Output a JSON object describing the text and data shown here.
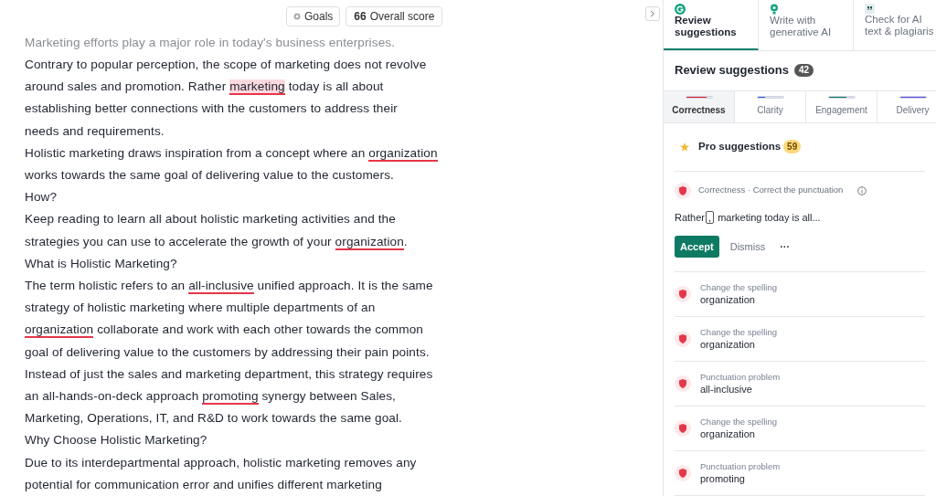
{
  "toolbar": {
    "goals": "Goals",
    "score_value": "66",
    "score_label": "Overall score"
  },
  "document": {
    "lines": [
      [
        {
          "kind": "plain",
          "text": "Marketing efforts play a major role in today's business enterprises."
        }
      ],
      [
        {
          "kind": "plain",
          "text": "Contrary to popular perception, the scope of marketing does not revolve"
        }
      ],
      [
        {
          "kind": "plain",
          "text": "around sales and promotion. Rather "
        },
        {
          "kind": "highlight",
          "text": "marketing"
        },
        {
          "kind": "plain",
          "text": " today is all about"
        }
      ],
      [
        {
          "kind": "plain",
          "text": "establishing better connections with the customers to address their"
        }
      ],
      [
        {
          "kind": "plain",
          "text": "needs and requirements."
        }
      ],
      [
        {
          "kind": "plain",
          "text": "Holistic marketing draws inspiration from a concept where an "
        },
        {
          "kind": "underline",
          "text": "organization"
        }
      ],
      [
        {
          "kind": "plain",
          "text": "works towards the same goal of delivering value to the customers."
        }
      ],
      [
        {
          "kind": "plain",
          "text": "How?"
        }
      ],
      [
        {
          "kind": "plain",
          "text": "Keep reading to learn all about holistic marketing activities and the"
        }
      ],
      [
        {
          "kind": "plain",
          "text": "strategies you can use to accelerate the growth of your "
        },
        {
          "kind": "underline",
          "text": "organization"
        },
        {
          "kind": "plain",
          "text": "."
        }
      ],
      [
        {
          "kind": "plain",
          "text": "What is Holistic Marketing?"
        }
      ],
      [
        {
          "kind": "plain",
          "text": "The term holistic refers to an "
        },
        {
          "kind": "underline",
          "text": "all-inclusive"
        },
        {
          "kind": "plain",
          "text": " unified approach. It is the same"
        }
      ],
      [
        {
          "kind": "plain",
          "text": "strategy of holistic marketing where multiple departments of an"
        }
      ],
      [
        {
          "kind": "underline",
          "text": "organization"
        },
        {
          "kind": "plain",
          "text": " collaborate and work with each other towards the common"
        }
      ],
      [
        {
          "kind": "plain",
          "text": "goal of delivering value to the customers by addressing their pain points."
        }
      ],
      [
        {
          "kind": "plain",
          "text": "Instead of just the sales and marketing department, this strategy requires"
        }
      ],
      [
        {
          "kind": "plain",
          "text": "an all-hands-on-deck approach "
        },
        {
          "kind": "underline",
          "text": "promoting"
        },
        {
          "kind": "plain",
          "text": " synergy between Sales,"
        }
      ],
      [
        {
          "kind": "plain",
          "text": "Marketing, Operations, IT, and R&D to work towards the same goal."
        }
      ],
      [
        {
          "kind": "plain",
          "text": "Why Choose Holistic Marketing?"
        }
      ],
      [
        {
          "kind": "plain",
          "text": "Due to its interdepartmental approach, holistic marketing removes any"
        }
      ],
      [
        {
          "kind": "plain",
          "text": "potential for communication error and unifies different marketing"
        }
      ]
    ]
  },
  "panel_tabs": [
    {
      "kind": "review",
      "lines": [
        "Review",
        "suggestions"
      ],
      "selected": true
    },
    {
      "kind": "write",
      "lines": [
        "Write with",
        "generative AI"
      ],
      "selected": false
    },
    {
      "kind": "check",
      "lines": [
        "Check for AI",
        "text & plagiaris"
      ],
      "selected": false
    }
  ],
  "heading": {
    "title": "Review suggestions",
    "count": "42"
  },
  "categories": [
    {
      "label": "Correctness",
      "color": "#e5252a",
      "level": 0.8,
      "selected": true
    },
    {
      "label": "Clarity",
      "color": "#3b5bdb",
      "level": 0.3,
      "selected": false
    },
    {
      "label": "Engagement",
      "color": "#0f7a64",
      "level": 0.7,
      "selected": false
    },
    {
      "label": "Delivery",
      "color": "#5a4ee8",
      "level": 1,
      "selected": false
    }
  ],
  "pro": {
    "label": "Pro suggestions",
    "count": "59"
  },
  "active_card": {
    "category": "Correctness · Correct the punctuation",
    "before": "Rather",
    "insert": ",",
    "after": " marketing today is all...",
    "accept": "Accept",
    "dismiss": "Dismiss",
    "more": "···"
  },
  "cards": [
    {
      "title": "Change the spelling",
      "word": "organization"
    },
    {
      "title": "Change the spelling",
      "word": "organization"
    },
    {
      "title": "Punctuation problem",
      "word": "all-inclusive"
    },
    {
      "title": "Change the spelling",
      "word": "organization"
    },
    {
      "title": "Punctuation problem",
      "word": "promoting"
    }
  ]
}
